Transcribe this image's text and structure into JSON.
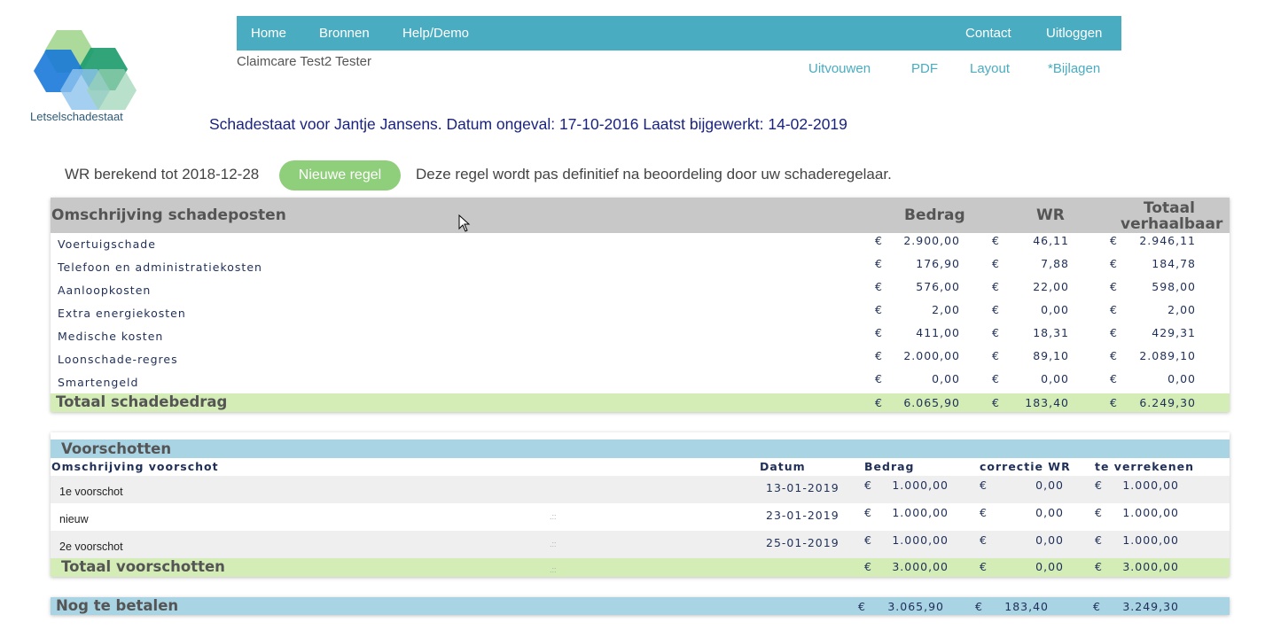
{
  "logo": {
    "text": "Letselschadestaat"
  },
  "nav": {
    "home": "Home",
    "bronnen": "Bronnen",
    "help": "Help/Demo",
    "contact": "Contact",
    "logout": "Uitloggen"
  },
  "user": {
    "name": "Claimcare Test2 Tester"
  },
  "subnav": {
    "expand": "Uitvouwen",
    "pdf": "PDF",
    "layout": "Layout",
    "attachments": "*Bijlagen"
  },
  "title": "Schadestaat voor Jantje Jansens. Datum ongeval: 17-10-2016 Laatst bijgewerkt: 14-02-2019",
  "wr": {
    "label": "WR berekend tot 2018-12-28",
    "button": "Nieuwe regel",
    "note": "Deze regel wordt pas definitief na beoordeling door uw schaderegelaar."
  },
  "currency": "€",
  "damages": {
    "headers": {
      "description": "Omschrijving schadeposten",
      "amount": "Bedrag",
      "wr": "WR",
      "total1": "Totaal",
      "total2": "verhaalbaar"
    },
    "rows": [
      {
        "desc": "Voertuigschade",
        "amount": "2.900,00",
        "wr": "46,11",
        "total": "2.946,11"
      },
      {
        "desc": "Telefoon en administratiekosten",
        "amount": "176,90",
        "wr": "7,88",
        "total": "184,78"
      },
      {
        "desc": "Aanloopkosten",
        "amount": "576,00",
        "wr": "22,00",
        "total": "598,00"
      },
      {
        "desc": "Extra energiekosten",
        "amount": "2,00",
        "wr": "0,00",
        "total": "2,00"
      },
      {
        "desc": "Medische kosten",
        "amount": "411,00",
        "wr": "18,31",
        "total": "429,31"
      },
      {
        "desc": "Loonschade-regres",
        "amount": "2.000,00",
        "wr": "89,10",
        "total": "2.089,10"
      },
      {
        "desc": "Smartengeld",
        "amount": "0,00",
        "wr": "0,00",
        "total": "0,00"
      }
    ],
    "total": {
      "label": "Totaal schadebedrag",
      "amount": "6.065,90",
      "wr": "183,40",
      "total": "6.249,30"
    }
  },
  "advances": {
    "title": "Voorschotten",
    "headers": {
      "description": "Omschrijving voorschot",
      "date": "Datum",
      "amount": "Bedrag",
      "correction": "correctie WR",
      "settle": "te verrekenen"
    },
    "rows": [
      {
        "desc": "1e voorschot",
        "date": "13-01-2019",
        "amount": "1.000,00",
        "correction": "0,00",
        "settle": "1.000,00"
      },
      {
        "desc": "nieuw",
        "date": "23-01-2019",
        "amount": "1.000,00",
        "correction": "0,00",
        "settle": "1.000,00"
      },
      {
        "desc": "2e voorschot",
        "date": "25-01-2019",
        "amount": "1.000,00",
        "correction": "0,00",
        "settle": "1.000,00"
      }
    ],
    "total": {
      "label": "Totaal voorschotten",
      "amount": "3.000,00",
      "correction": "0,00",
      "settle": "3.000,00"
    }
  },
  "balance": {
    "label": "Nog te betalen",
    "amount": "3.065,90",
    "wr": "183,40",
    "total": "3.249,30"
  }
}
